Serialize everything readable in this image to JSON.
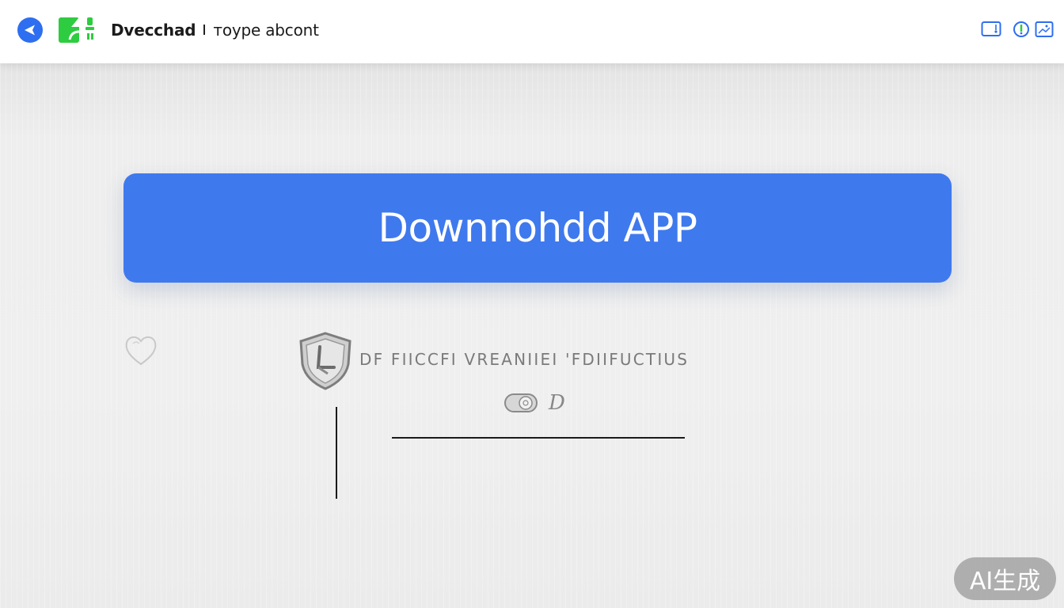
{
  "header": {
    "back_icon": "back-arrow-icon",
    "logo_icon": "app-logo-icon",
    "title": "Dvecchad",
    "subtitle": "ᴛoype abcont",
    "right_icons": [
      "tablet-icon",
      "shield-badge-icon",
      "image-frame-icon"
    ]
  },
  "main": {
    "download_button_label": "Downnohdd APP",
    "heart_icon": "heart-icon",
    "shield_icon": "shield-check-icon",
    "security_text": "DF FIICCFI VREANIIEI 'FDIIFUCTIUS",
    "toggle_label": "D",
    "input_value": ""
  },
  "watermark": {
    "text": "AI生成"
  },
  "colors": {
    "accent": "#3f79ee",
    "back_button": "#2e6ef0",
    "logo_green": "#2ecc40",
    "page_bg": "#ececec"
  }
}
